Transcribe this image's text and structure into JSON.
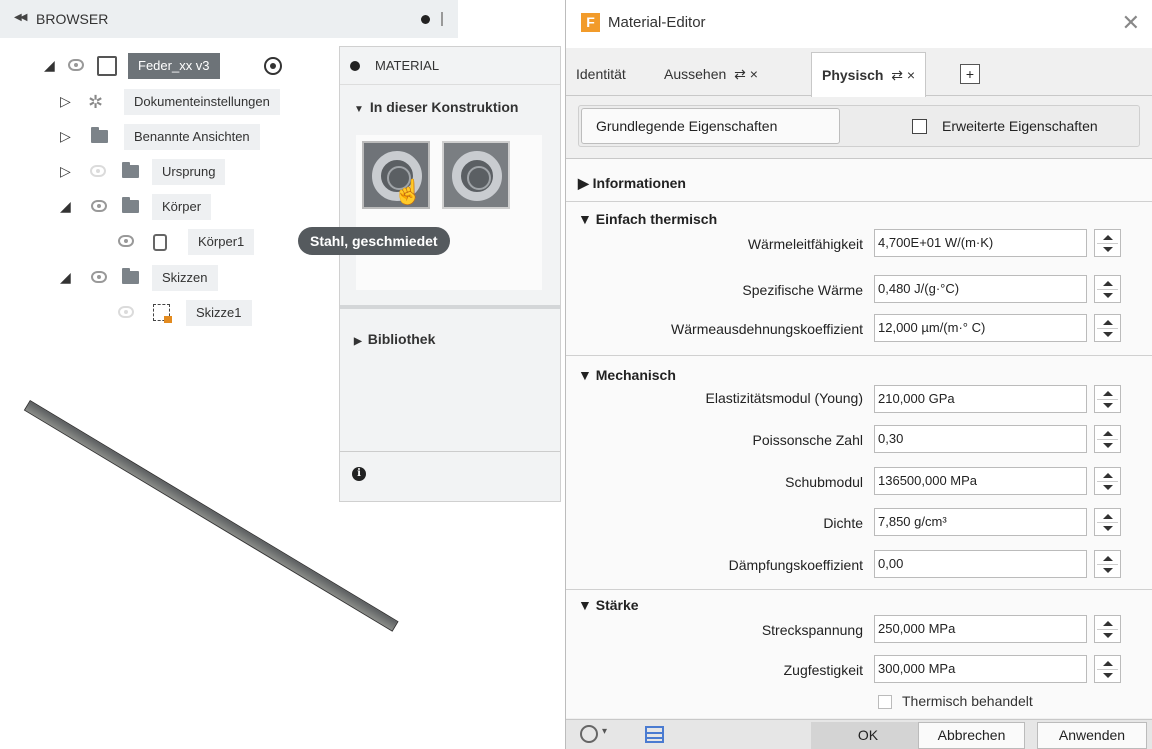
{
  "browser": {
    "title": "BROWSER",
    "root_label": "Feder_xx v3",
    "items": [
      {
        "label": "Dokumenteinstellungen"
      },
      {
        "label": "Benannte Ansichten"
      },
      {
        "label": "Ursprung"
      },
      {
        "label": "Körper"
      },
      {
        "label": "Körper1"
      },
      {
        "label": "Skizzen"
      },
      {
        "label": "Skizze1"
      }
    ]
  },
  "material_panel": {
    "title": "MATERIAL",
    "section_design": "In dieser Konstruktion",
    "section_library": "Bibliothek",
    "tooltip": "Stahl, geschmiedet"
  },
  "editor": {
    "title": "Material-Editor",
    "tabs": [
      {
        "label": "Identität"
      },
      {
        "label": "Aussehen"
      },
      {
        "label": "Physisch"
      }
    ],
    "basic_label": "Grundlegende Eigenschaften",
    "advanced_label": "Erweiterte Eigenschaften",
    "section_info": "Informationen",
    "section_thermal": "Einfach thermisch",
    "section_mech": "Mechanisch",
    "section_strength": "Stärke",
    "thermal": [
      {
        "label": "Wärmeleitfähigkeit",
        "value": "4,700E+01 W/(m·K)"
      },
      {
        "label": "Spezifische Wärme",
        "value": "0,480 J/(g·°C)"
      },
      {
        "label": "Wärmeausdehnungskoeffizient",
        "value": "12,000 µm/(m·° C)"
      }
    ],
    "mechanical": [
      {
        "label": "Elastizitätsmodul (Young)",
        "value": "210,000 GPa"
      },
      {
        "label": "Poissonsche Zahl",
        "value": "0,30"
      },
      {
        "label": "Schubmodul",
        "value": "136500,000 MPa"
      },
      {
        "label": "Dichte",
        "value": "7,850 g/cm³"
      },
      {
        "label": "Dämpfungskoeffizient",
        "value": "0,00"
      }
    ],
    "strength": [
      {
        "label": "Streckspannung",
        "value": "250,000 MPa"
      },
      {
        "label": "Zugfestigkeit",
        "value": "300,000 MPa"
      }
    ],
    "heat_treated": "Thermisch behandelt",
    "buttons": {
      "ok": "OK",
      "cancel": "Abbrechen",
      "apply": "Anwenden"
    }
  }
}
